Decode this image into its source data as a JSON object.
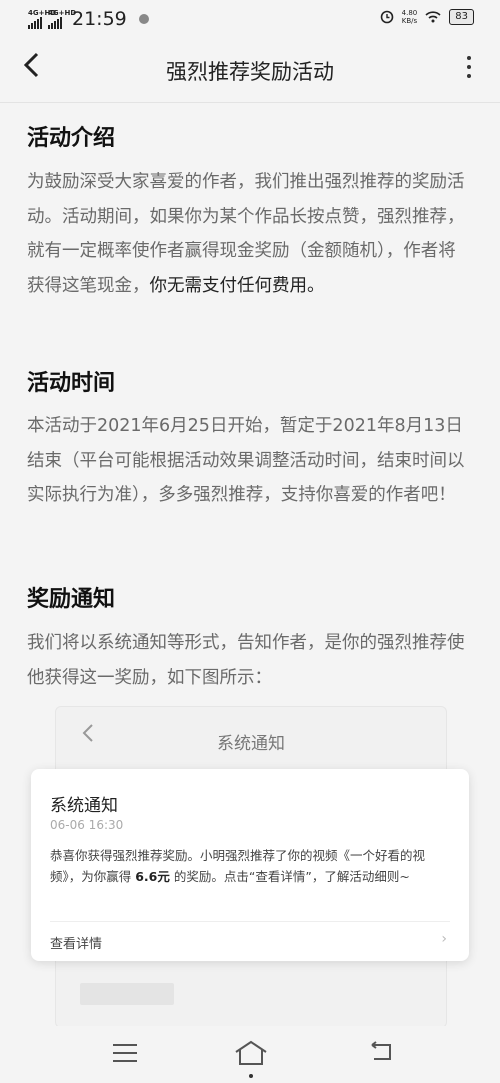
{
  "status_bar": {
    "network1": "4G+HD",
    "network2": "4G+HD",
    "time": "21:59",
    "speed_value": "4.80",
    "speed_unit": "KB/s",
    "battery": "83"
  },
  "header": {
    "title": "强烈推荐奖励活动"
  },
  "sections": [
    {
      "heading": "活动介绍",
      "body": "为鼓励深受大家喜爱的作者，我们推出强烈推荐的奖励活动。活动期间，如果你为某个作品长按点赞，强烈推荐，就有一定概率使作者赢得现金奖励（金额随机），作者将获得这笔现金，",
      "body_emphasis": "你无需支付任何费用。"
    },
    {
      "heading": "活动时间",
      "body": "本活动于2021年6月25日开始，暂定于2021年8月13日结束（平台可能根据活动效果调整活动时间，结束时间以实际执行为准），多多强烈推荐，支持你喜爱的作者吧！"
    },
    {
      "heading": "奖励通知",
      "body": "我们将以系统通知等形式，告知作者，是你的强烈推荐使他获得这一奖励，如下图所示："
    }
  ],
  "preview": {
    "title": "系统通知",
    "card": {
      "title": "系统通知",
      "date": "06-06 16:30",
      "body_pre": "恭喜你获得强烈推荐奖励。小明强烈推荐了你的视频《一个好看的视频》，为你赢得 ",
      "amount": "6.6元",
      "body_post": " 的奖励。点击“查看详情”，了解活动细则~",
      "link": "查看详情"
    }
  },
  "icons": {
    "back": "chevron-left-icon",
    "more": "more-vertical-icon",
    "nav_menu": "menu-icon",
    "nav_home": "home-icon",
    "nav_back": "back-icon"
  }
}
